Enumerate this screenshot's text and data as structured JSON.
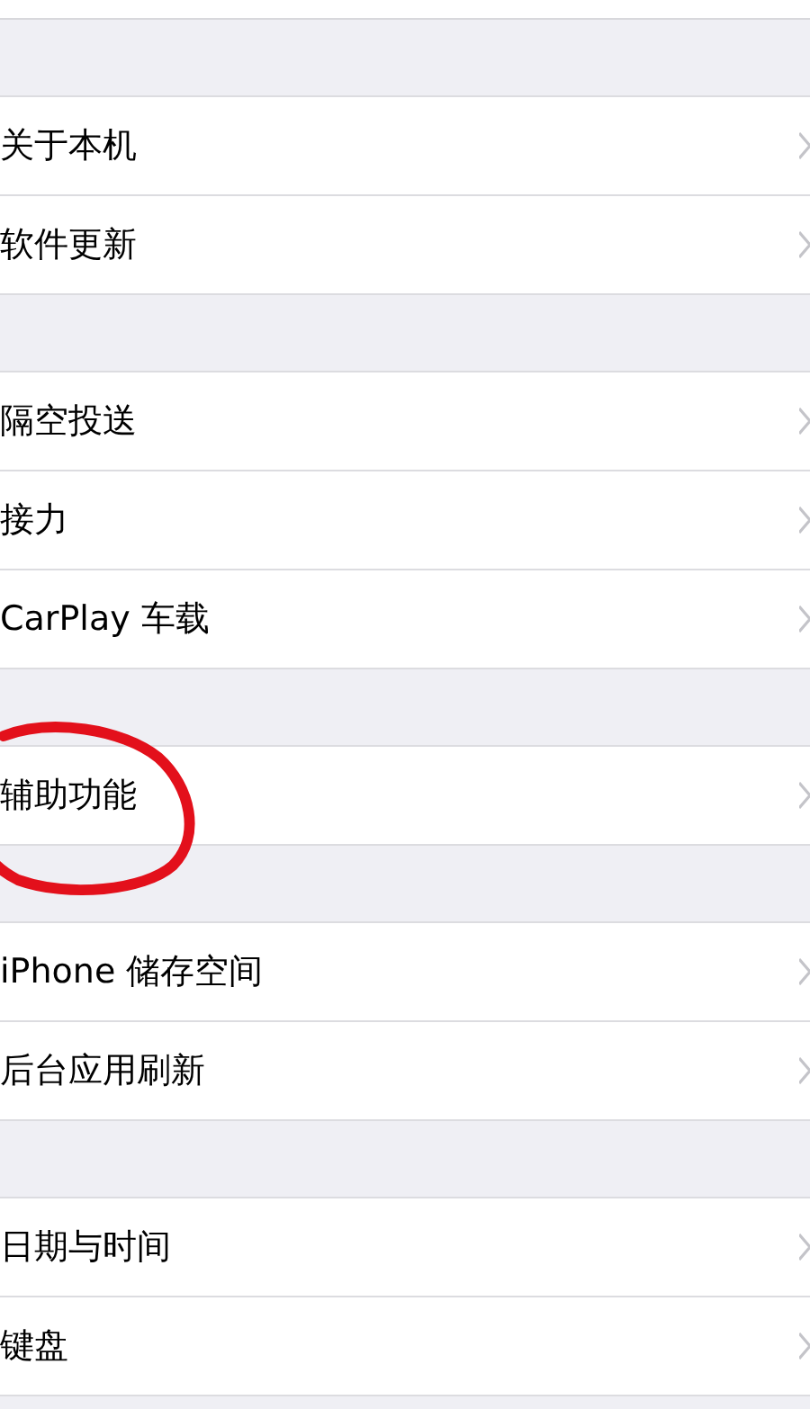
{
  "groups": [
    {
      "rows": [
        {
          "label": "关于本机",
          "circled": false
        },
        {
          "label": "软件更新",
          "circled": false
        }
      ]
    },
    {
      "rows": [
        {
          "label": "隔空投送",
          "circled": false
        },
        {
          "label": "接力",
          "circled": false
        },
        {
          "label": "CarPlay 车载",
          "circled": false
        }
      ]
    },
    {
      "rows": [
        {
          "label": "辅助功能",
          "circled": true
        }
      ]
    },
    {
      "rows": [
        {
          "label": "iPhone 储存空间",
          "circled": false
        },
        {
          "label": "后台应用刷新",
          "circled": false
        }
      ]
    },
    {
      "rows": [
        {
          "label": "日期与时间",
          "circled": false
        },
        {
          "label": "键盘",
          "circled": false
        }
      ]
    }
  ]
}
